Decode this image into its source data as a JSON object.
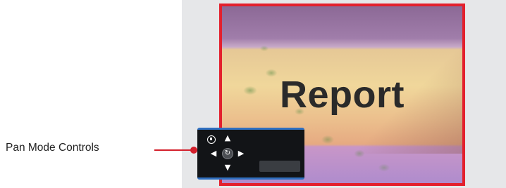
{
  "slide": {
    "text": "Report"
  },
  "pan_controls": {
    "callout_label": "Pan Mode Controls",
    "icons": {
      "zoom": "zoom-icon",
      "up": "arrow-up-icon",
      "down": "arrow-down-icon",
      "left": "arrow-left-icon",
      "right": "arrow-right-icon",
      "center": "rotate-icon"
    },
    "glyphs": {
      "up": "▲",
      "down": "▼",
      "left": "◀",
      "right": "▶",
      "center": "↻"
    }
  },
  "colors": {
    "frame_border": "#e3202d",
    "panel_accent": "#2f6fc0",
    "callout": "#d41f2b"
  }
}
